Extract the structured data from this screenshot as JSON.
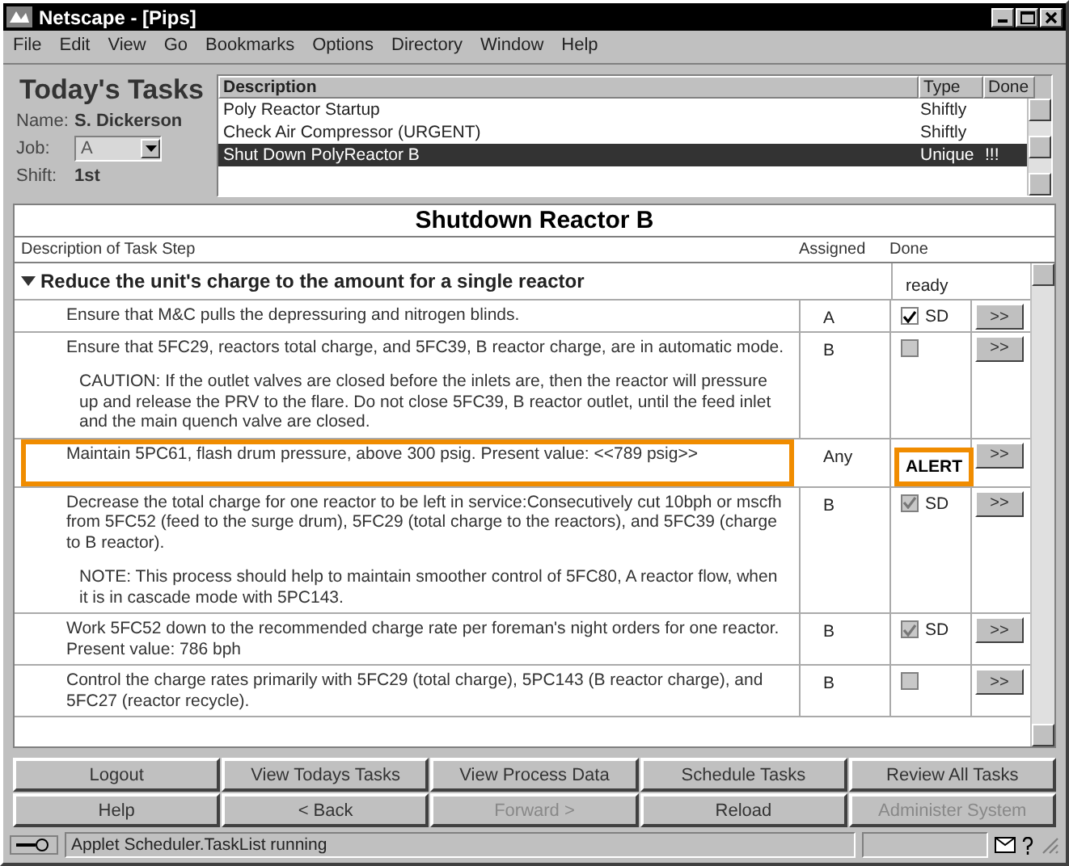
{
  "window": {
    "title": "Netscape - [Pips]"
  },
  "menu": [
    "File",
    "Edit",
    "View",
    "Go",
    "Bookmarks",
    "Options",
    "Directory",
    "Window",
    "Help"
  ],
  "tasks_panel": {
    "heading": "Today's Tasks",
    "name_label": "Name:",
    "name": "S. Dickerson",
    "job_label": "Job:",
    "job": "A",
    "shift_label": "Shift:",
    "shift": "1st"
  },
  "task_list": {
    "columns": [
      "Description",
      "Type",
      "Done"
    ],
    "rows": [
      {
        "description": "Poly Reactor Startup",
        "type": "Shiftly",
        "done": "",
        "selected": false
      },
      {
        "description": "Check Air Compressor (URGENT)",
        "type": "Shiftly",
        "done": "",
        "selected": false
      },
      {
        "description": "Shut Down PolyReactor B",
        "type": "Unique",
        "done": "!!!",
        "selected": true
      }
    ]
  },
  "task_detail": {
    "title": "Shutdown  Reactor B",
    "columns": [
      "Description of Task Step",
      "Assigned",
      "Done"
    ],
    "group": {
      "label": "Reduce the unit's charge to the amount for a single reactor",
      "expanded": true,
      "status": "ready"
    },
    "steps": [
      {
        "text": "Ensure that M&C pulls the depressuring and nitrogen blinds.",
        "assigned": "A",
        "kind": "checkbox",
        "checked": true,
        "disabled": false,
        "done_label": "SD",
        "highlighted": false,
        "action": ">>"
      },
      {
        "text": "Ensure that 5FC29, reactors total charge, and 5FC39, B reactor charge, are in automatic mode.",
        "note": "CAUTION: If the outlet valves are closed before the inlets are, then the reactor will pressure up and release the PRV to the flare. Do not close 5FC39, B reactor outlet, until the feed inlet and the main quench valve are closed.",
        "assigned": "B",
        "kind": "checkbox",
        "checked": false,
        "disabled": true,
        "highlighted": false,
        "action": ">>"
      },
      {
        "text": "Maintain 5PC61, flash drum pressure, above 300 psig. Present value:  <<789 psig>>",
        "assigned": "Any",
        "kind": "alert",
        "alert": "ALERT",
        "highlighted": true,
        "action": ">>"
      },
      {
        "text": "Decrease the total charge for one reactor to be left in service:Consecutively cut 10bph or mscfh from 5FC52 (feed to the surge drum), 5FC29 (total charge to the reactors), and 5FC39 (charge to B reactor).",
        "note": "NOTE: This process should help to maintain smoother control of 5FC80, A reactor flow, when it is in cascade mode with 5PC143.",
        "assigned": "B",
        "kind": "checkbox",
        "checked": true,
        "disabled": true,
        "done_label": "SD",
        "highlighted": false,
        "action": ">>"
      },
      {
        "text": "Work 5FC52 down to the recommended charge rate per foreman's night orders for one reactor. Present value:  786 bph",
        "assigned": "B",
        "kind": "checkbox",
        "checked": true,
        "disabled": true,
        "done_label": "SD",
        "highlighted": false,
        "action": ">>"
      },
      {
        "text": "Control the charge rates primarily with 5FC29 (total charge), 5PC143 (B reactor charge), and 5FC27 (reactor recycle).",
        "assigned": "B",
        "kind": "checkbox",
        "checked": false,
        "disabled": true,
        "highlighted": false,
        "action": ">>"
      }
    ]
  },
  "buttons": [
    {
      "label": "Logout",
      "disabled": false
    },
    {
      "label": "View Todays Tasks",
      "disabled": false
    },
    {
      "label": "View Process Data",
      "disabled": false
    },
    {
      "label": "Schedule Tasks",
      "disabled": false
    },
    {
      "label": "Review All Tasks",
      "disabled": false
    },
    {
      "label": "Help",
      "disabled": false
    },
    {
      "label": "< Back",
      "disabled": false
    },
    {
      "label": "Forward >",
      "disabled": true
    },
    {
      "label": "Reload",
      "disabled": false
    },
    {
      "label": "Administer System",
      "disabled": true
    }
  ],
  "status_bar": {
    "text": "Applet Scheduler.TaskList running"
  }
}
